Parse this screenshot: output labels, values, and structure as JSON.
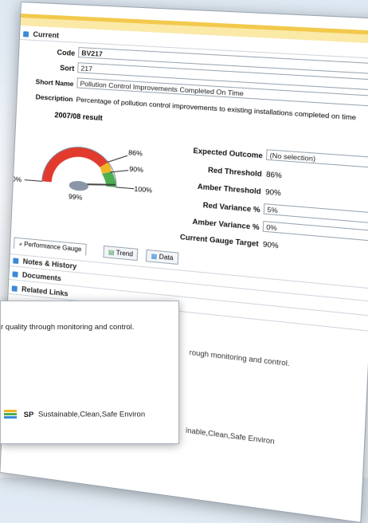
{
  "current_section": "Current",
  "fields": {
    "code_label": "Code",
    "code_value": "BV217",
    "sort_label": "Sort",
    "sort_value": "217",
    "short_name_label": "Short Name",
    "short_name_value": "Pollution Control Improvements Completed On Time",
    "description_label": "Description",
    "description_value": "Percentage of pollution control improvements to existing installations completed on time"
  },
  "gauge": {
    "title": "2007/08 result",
    "min_label": "0%",
    "value_label": "99%",
    "max_label": "100%",
    "red_label": "86%",
    "amber_label": "90%",
    "value": 99,
    "red_threshold": 86,
    "amber_threshold": 90
  },
  "outcome": {
    "expected_label": "Expected Outcome",
    "expected_value": "(No selection)",
    "red_threshold_label": "Red Threshold",
    "red_threshold_value": "86%",
    "amber_threshold_label": "Amber Threshold",
    "amber_threshold_value": "90%",
    "red_variance_label": "Red Variance %",
    "red_variance_value": "5%",
    "amber_variance_label": "Amber Variance %",
    "amber_variance_value": "0%",
    "current_target_label": "Current Gauge Target",
    "current_target_value": "90%"
  },
  "tabs": [
    "Performance Gauge",
    "Trend",
    "Data"
  ],
  "sections": [
    "Notes & History",
    "Documents",
    "Related Links"
  ],
  "background_text": {
    "line1": "rough monitoring and control.",
    "line2": "inable,Clean,Safe Environ"
  },
  "popup": {
    "text": "r quality through monitoring and control.",
    "sp_code": "SP",
    "sp_label": "Sustainable,Clean,Safe Environ"
  },
  "colors": {
    "red": "#e23b2e",
    "amber": "#f0b429",
    "green": "#4caf50",
    "accent": "#3b8bd6",
    "yellow": "#f2c94c"
  }
}
